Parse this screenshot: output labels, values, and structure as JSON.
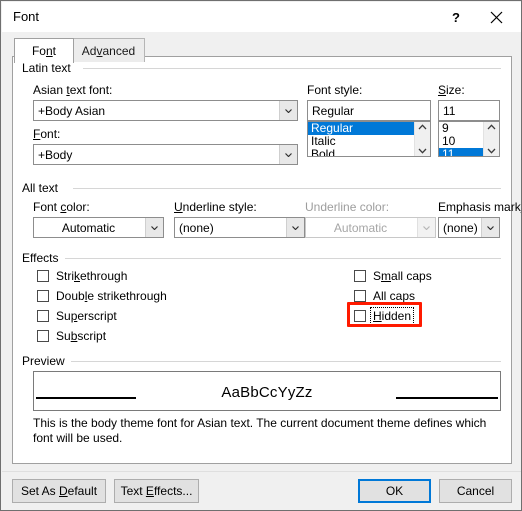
{
  "window": {
    "title": "Font",
    "help_icon": "question-mark-icon",
    "close_icon": "close-icon"
  },
  "tabs": [
    {
      "label": "Font",
      "accel": "n",
      "active": true
    },
    {
      "label": "Advanced",
      "accel": "v",
      "active": false
    }
  ],
  "groups": {
    "latin_text": {
      "label": "Latin text"
    },
    "all_text": {
      "label": "All text"
    },
    "effects": {
      "label": "Effects"
    },
    "preview": {
      "label": "Preview"
    }
  },
  "latin_text": {
    "asian_font": {
      "label": "Asian text font:",
      "value": "+Body Asian"
    },
    "font": {
      "label": "Font:",
      "value": "+Body"
    },
    "font_style": {
      "label": "Font style:",
      "value": "Regular",
      "options": [
        "Regular",
        "Italic",
        "Bold"
      ],
      "selected": "Regular"
    },
    "size": {
      "label": "Size:",
      "value": "11",
      "options": [
        "9",
        "10",
        "11"
      ],
      "selected": "11"
    }
  },
  "all_text": {
    "font_color": {
      "label": "Font color:",
      "value": "Automatic",
      "disabled": false
    },
    "underline_style": {
      "label": "Underline style:",
      "value": "(none)",
      "disabled": false
    },
    "underline_color": {
      "label": "Underline color:",
      "value": "Automatic",
      "disabled": true
    },
    "emphasis_mark": {
      "label": "Emphasis mark:",
      "value": "(none)",
      "disabled": false
    }
  },
  "effects": {
    "left": [
      {
        "label": "Strikethrough",
        "checked": false
      },
      {
        "label": "Double strikethrough",
        "checked": false
      },
      {
        "label": "Superscript",
        "checked": false
      },
      {
        "label": "Subscript",
        "checked": false
      }
    ],
    "right": [
      {
        "label": "Small caps",
        "checked": false,
        "focused": false,
        "highlighted": false
      },
      {
        "label": "All caps",
        "checked": false,
        "focused": false,
        "highlighted": false
      },
      {
        "label": "Hidden",
        "checked": false,
        "focused": true,
        "highlighted": true
      }
    ]
  },
  "preview": {
    "sample_text": "AaBbCcYyZz",
    "note": "This is the body theme font for Asian text. The current document theme defines which font will be used."
  },
  "footer": {
    "set_as_default": "Set As Default",
    "text_effects": "Text Effects...",
    "ok": "OK",
    "cancel": "Cancel"
  },
  "colors": {
    "selection_blue": "#0078d7",
    "annotation_red": "#ff1a00",
    "dialog_bg": "#f0f0f0",
    "panel_bg": "#ffffff",
    "disabled_text": "#a6a6a6"
  }
}
